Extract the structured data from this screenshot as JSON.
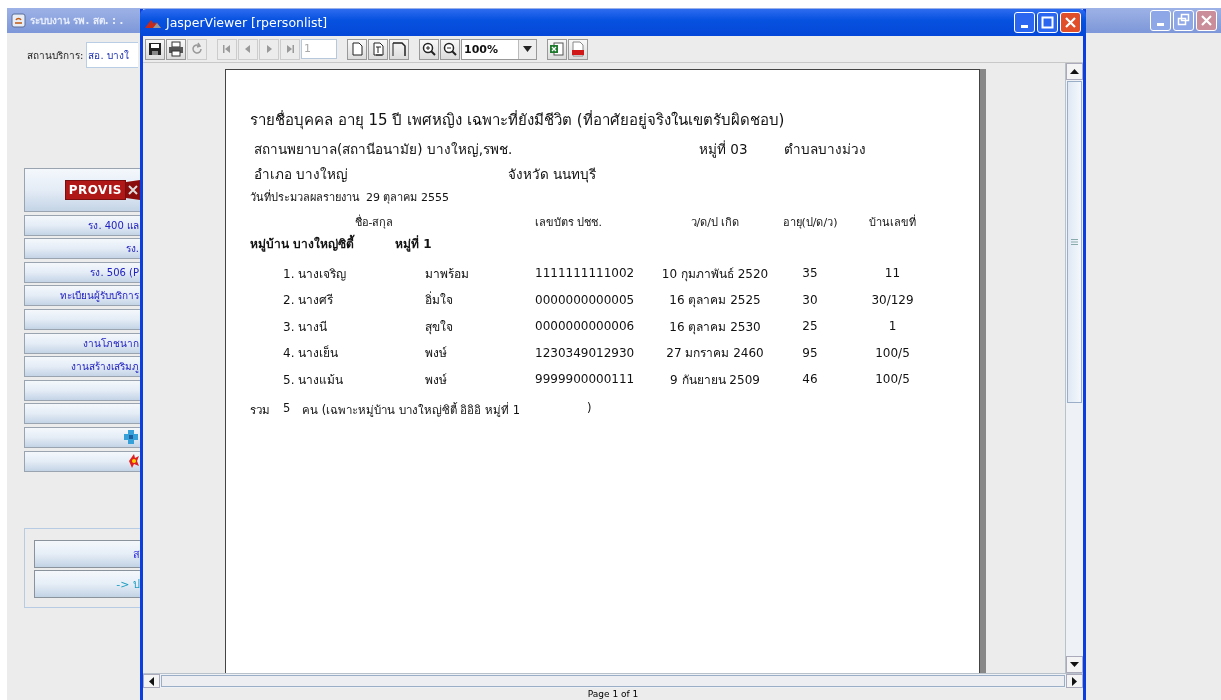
{
  "background_window": {
    "title": "ระบบงาน รพ. สต. : .",
    "service_label": "สถานบริการ:",
    "service_value": "สอ. บางใ",
    "logo": "PROVIS",
    "menu_items": [
      {
        "kind": "text",
        "label": "รง. 400 แล"
      },
      {
        "kind": "text",
        "label": "รง."
      },
      {
        "kind": "text",
        "label": "รง. 506 (P"
      },
      {
        "kind": "text",
        "label": "ทะเบียนผู้รับบริการ"
      },
      {
        "kind": "blank"
      },
      {
        "kind": "text",
        "label": "งานโภชนาก"
      },
      {
        "kind": "text",
        "label": "งานสร้างเสริมภู"
      },
      {
        "kind": "blank"
      },
      {
        "kind": "blank"
      },
      {
        "kind": "cross"
      },
      {
        "kind": "burst"
      }
    ],
    "panel_buttons": [
      {
        "label": "ส"
      },
      {
        "label": "-> ป"
      }
    ]
  },
  "viewer": {
    "title": "JasperViewer [rpersonlist]",
    "toolbar": [
      [
        {
          "kind": "save",
          "disabled": false
        },
        {
          "kind": "print",
          "disabled": false
        },
        {
          "kind": "reload",
          "disabled": true
        }
      ],
      [
        {
          "kind": "first",
          "disabled": true
        },
        {
          "kind": "prev",
          "disabled": true
        },
        {
          "kind": "next",
          "disabled": true
        },
        {
          "kind": "last",
          "disabled": true
        },
        {
          "kind": "page-field",
          "value": "1"
        }
      ],
      [
        {
          "kind": "actual-size",
          "disabled": false
        },
        {
          "kind": "fit-page",
          "disabled": false
        },
        {
          "kind": "fit-width",
          "disabled": false
        }
      ],
      [
        {
          "kind": "zoom-in",
          "disabled": false
        },
        {
          "kind": "zoom-out",
          "disabled": false
        },
        {
          "kind": "zoom-combo",
          "value": "100%"
        }
      ],
      [
        {
          "kind": "excel",
          "disabled": false
        },
        {
          "kind": "pdf",
          "disabled": false
        }
      ]
    ],
    "report": {
      "title": "รายชื่อบุคคล อายุ 15 ปี เพศหญิง เฉพาะที่ยังมีชีวิต (ที่อาศัยอยู่จริงในเขตรับผิดชอบ)",
      "hospital": "สถานพยาบาล(สถานีอนามัย) บางใหญ่,รพช.",
      "village_no": "หมู่ที่ 03",
      "subdistrict": "ตำบลบางม่วง",
      "district": "อำเภอ บางใหญ่",
      "province": "จังหวัด นนทบุรี",
      "date_label": "วันที่ประมวลผลรายงาน",
      "date": "29 ตุลาคม 2555",
      "columns": [
        "ชื่อ-สกุล",
        "เลขบัตร ปชช.",
        "ว/ด/ป เกิด",
        "อายุ(ป/ด/ว)",
        "บ้านเลขที่"
      ],
      "group": {
        "village": "หมู่บ้าน บางใหญ่ซิตี้",
        "village_no": "หมู่ที่ 1"
      },
      "rows": [
        {
          "name": "1. นางเจริญ",
          "surname": "มาพร้อม",
          "id": "1111111111002",
          "birth": "10 กุมภาพันธ์ 2520",
          "age": "35",
          "house": "11"
        },
        {
          "name": "2. นางศรี",
          "surname": "อิ่มใจ",
          "id": "0000000000005",
          "birth": "16 ตุลาคม 2525",
          "age": "30",
          "house": "30/129"
        },
        {
          "name": "3. นางนี",
          "surname": "สุขใจ",
          "id": "0000000000006",
          "birth": "16 ตุลาคม 2530",
          "age": "25",
          "house": "1"
        },
        {
          "name": "4. นางเย็น",
          "surname": "พงษ์",
          "id": "1230349012930",
          "birth": "27 มกราคม 2460",
          "age": "95",
          "house": "100/5"
        },
        {
          "name": "5. นางแม้น",
          "surname": "พงษ์",
          "id": "9999900000111",
          "birth": "9 กันยายน 2509",
          "age": "46",
          "house": "100/5"
        }
      ],
      "summary": {
        "label": "รวม",
        "count": "5",
        "text": "คน (เฉพาะหมู่บ้าน บางใหญ่ซิตี้ อิอิอิ หมู่ที่ 1",
        "close": ")"
      }
    },
    "status": "Page 1 of 1"
  }
}
